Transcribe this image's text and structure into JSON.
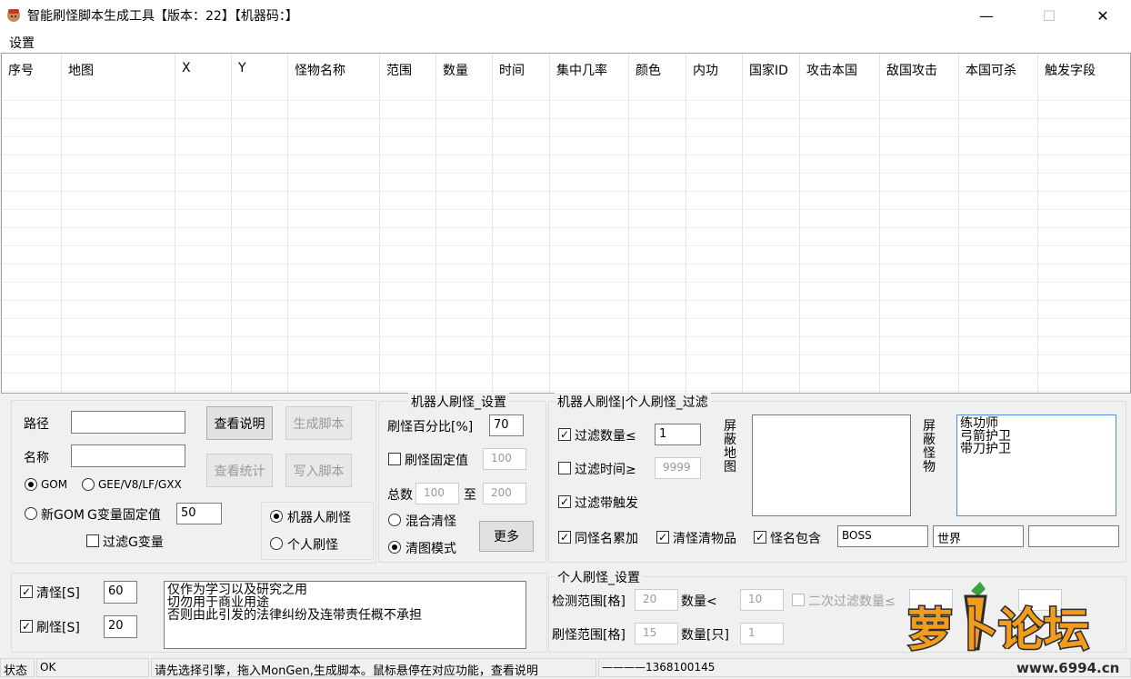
{
  "window": {
    "title": "智能刷怪脚本生成工具【版本：22】【机器码：】",
    "minimize_label": "—",
    "maximize_label": "☐",
    "close_label": "✕"
  },
  "menu": {
    "settings": "设置"
  },
  "grid": {
    "columns": [
      "序号",
      "地图",
      "X",
      "Y",
      "怪物名称",
      "范围",
      "数量",
      "时间",
      "集中几率",
      "颜色",
      "内功",
      "国家ID",
      "攻击本国",
      "敌国攻击",
      "本国可杀",
      "触发字段"
    ]
  },
  "path_panel": {
    "path_label": "路径",
    "path_value": "",
    "name_label": "名称",
    "name_value": "",
    "view_help": "查看说明",
    "gen_script": "生成脚本",
    "view_stats": "查看统计",
    "write_script": "写入脚本",
    "engine_gom": "GOM",
    "engine_gee": "GEE/V8/LF/GXX",
    "engine_newgom": "新GOM",
    "g_var_label": "G变量固定值",
    "g_var_value": "50",
    "filter_g_var": "过滤G变量",
    "mode_robot": "机器人刷怪",
    "mode_personal": "个人刷怪"
  },
  "robot_settings": {
    "title": "机器人刷怪_设置",
    "percent_label": "刷怪百分比[%]",
    "percent_value": "70",
    "fixed_label": "刷怪固定值",
    "fixed_value": "100",
    "total_label": "总数",
    "total_from": "100",
    "to_label": "至",
    "total_to": "200",
    "mixed_clear": "混合清怪",
    "clear_map_mode": "清图模式",
    "more_button": "更多"
  },
  "filter": {
    "title": "机器人刷怪|个人刷怪_过滤",
    "filter_count_label": "过滤数量≤",
    "filter_count_value": "1",
    "filter_time_label": "过滤时间≥",
    "filter_time_value": "9999",
    "filter_trigger": "过滤带触发",
    "same_name_sum": "同怪名累加",
    "clear_items": "清怪清物品",
    "name_contains": "怪名包含",
    "contains_1": "BOSS",
    "contains_2": "世界",
    "contains_3": "",
    "block_map_label": "屏蔽地图",
    "block_map_text": "",
    "block_monster_label": "屏蔽怪物",
    "block_monster_text": "练功师\n弓箭护卫\n带刀护卫"
  },
  "clear_panel": {
    "clear_label": "清怪[S]",
    "clear_value": "60",
    "spawn_label": "刷怪[S]",
    "spawn_value": "20",
    "notice": "仅作为学习以及研究之用\n切勿用于商业用途\n否则由此引发的法律纠纷及连带责任概不承担"
  },
  "personal_settings": {
    "title": "个人刷怪_设置",
    "detect_range_label": "检测范围[格]",
    "detect_range_value": "20",
    "count_lt_label": "数量<",
    "count_lt_value": "10",
    "second_filter_label": "二次过滤数量≤",
    "spawn_range_label": "刷怪范围[格]",
    "spawn_range_value": "15",
    "count_only_label": "数量[只]",
    "count_only_value": "1"
  },
  "status": {
    "label": "状态",
    "state": "OK",
    "message": "请先选择引擎，拖入MonGen,生成脚本。鼠标悬停在对应功能，查看说明",
    "contact": "————1368100145"
  },
  "watermark": {
    "text": "萝卜论坛",
    "site": "www.6994.cn"
  },
  "colors": {
    "accent_blue": "#4a90d9",
    "watermark_orange": "#f29b1d",
    "watermark_dark": "#2b2b2b"
  }
}
